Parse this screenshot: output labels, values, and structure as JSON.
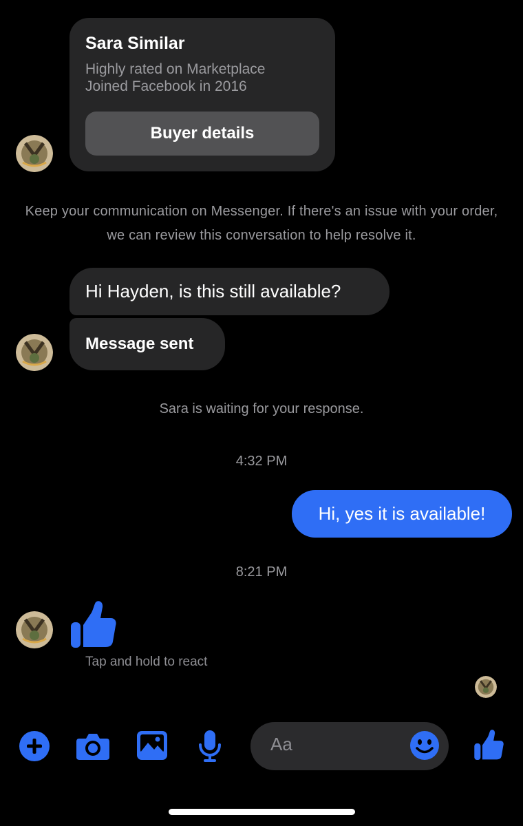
{
  "buyer_card": {
    "name": "Sara Similar",
    "line1": "Highly rated on Marketplace",
    "line2": "Joined Facebook in 2016",
    "button_label": "Buyer details"
  },
  "notice": "Keep your communication on Messenger. If there's an issue with your order, we can review this conversation to help resolve it.",
  "messages": {
    "incoming_1": "Hi Hayden, is this still available?",
    "incoming_2": "Message sent",
    "waiting_status": "Sara is waiting for your response.",
    "time_1": "4:32 PM",
    "outgoing_1": "Hi, yes it is available!",
    "time_2": "8:21 PM",
    "reaction_hint": "Tap and hold to react"
  },
  "composer": {
    "placeholder": "Aa"
  },
  "icons": [
    "plus-icon",
    "camera-icon",
    "image-icon",
    "microphone-icon",
    "emoji-icon",
    "thumbs-up-icon"
  ],
  "colors": {
    "accent": "#2f6ef5",
    "bubble_incoming": "#262627",
    "background": "#000000"
  }
}
